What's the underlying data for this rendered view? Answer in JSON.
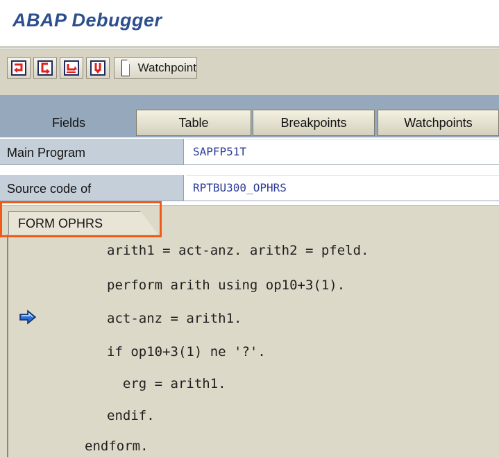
{
  "window": {
    "title": "ABAP Debugger"
  },
  "toolbar": {
    "buttons": [
      {
        "name": "single-step",
        "icon": "single-step-icon",
        "color": "#e0201c"
      },
      {
        "name": "execute",
        "icon": "execute-icon",
        "color": "#e0201c"
      },
      {
        "name": "return",
        "icon": "return-icon",
        "color": "#e0201c"
      },
      {
        "name": "continue",
        "icon": "continue-icon",
        "color": "#e0201c"
      }
    ],
    "watchpoint_label": "Watchpoint"
  },
  "tabs": {
    "fields": "Fields",
    "table": "Table",
    "breakpoints": "Breakpoints",
    "watchpoints": "Watchpoints"
  },
  "info": {
    "main_program_label": "Main Program",
    "main_program_value": "SAPFP51T",
    "source_code_label": "Source code of",
    "source_code_value": "RPTBU300_OPHRS"
  },
  "form_tab": {
    "label": "FORM OPHRS"
  },
  "code": {
    "lines": [
      "arith1 = act-anz. arith2 = pfeld.",
      "perform arith using op10+3(1).",
      "act-anz = arith1.",
      "if op10+3(1) ne '?'.",
      "  erg = arith1.",
      "endif.",
      "endform."
    ],
    "current_line_index": 2
  },
  "colors": {
    "title": "#2c4f8e",
    "highlight": "#f05a14",
    "current_line_arrow": "#2a6fd6"
  }
}
